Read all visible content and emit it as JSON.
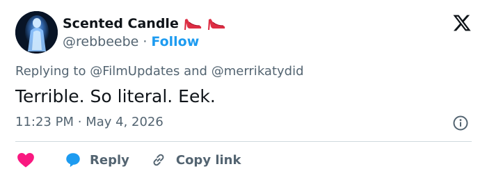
{
  "header": {
    "display_name": "Scented Candle",
    "handle": "@rebbeebe",
    "separator": "·",
    "follow_label": "Follow"
  },
  "reply_context": {
    "prefix": "Replying to",
    "mention_1": "@FilmUpdates",
    "conjunction": "and",
    "mention_2": "@merrikatydid"
  },
  "tweet": {
    "text": "Terrible. So literal. Eek.",
    "time": "11:23 PM",
    "separator": "·",
    "date": "May 4, 2026"
  },
  "actions": {
    "reply_label": "Reply",
    "copy_link_label": "Copy link"
  },
  "icons": {
    "brand": "x-logo-icon",
    "name_decoration": "high-heel-shoe-icon",
    "info": "info-icon",
    "like": "heart-icon",
    "reply": "speech-bubble-icon",
    "copy": "link-icon"
  },
  "colors": {
    "text_primary": "#0f1419",
    "text_secondary": "#536471",
    "accent": "#1d9bf0",
    "heart": "#f91880",
    "divider": "#cfd9de"
  }
}
